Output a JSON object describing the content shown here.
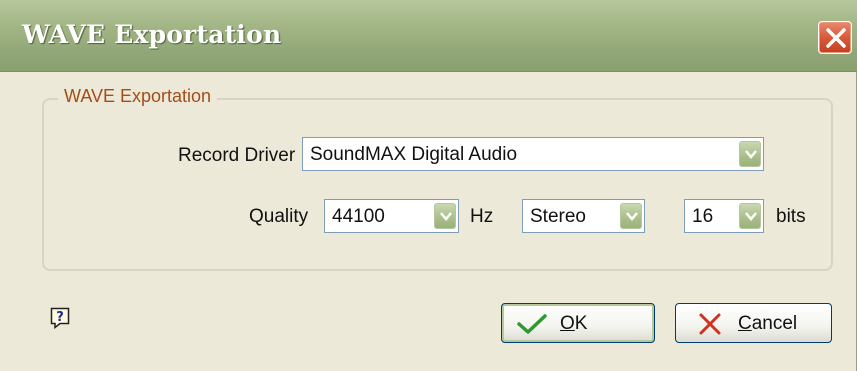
{
  "window": {
    "title": "WAVE Exportation"
  },
  "group": {
    "legend": "WAVE Exportation"
  },
  "record_driver": {
    "label": "Record Driver",
    "value": "SoundMAX Digital Audio"
  },
  "quality": {
    "label": "Quality",
    "rate_value": "44100",
    "rate_unit": "Hz",
    "channels_value": "Stereo",
    "bits_value": "16",
    "bits_unit": "bits"
  },
  "buttons": {
    "ok_prefix": "",
    "ok_mnemonic": "O",
    "ok_rest": "K",
    "cancel_mnemonic": "C",
    "cancel_rest": "ancel"
  },
  "icons": {
    "close": "close-icon",
    "help": "help-icon",
    "ok": "checkmark-icon",
    "cancel": "x-icon",
    "dropdown": "chevron-down-icon"
  },
  "colors": {
    "titlebar": "#a3b686",
    "legend_text": "#a34e1a",
    "close_button": "#d85a3a",
    "ok_icon": "#2e9a2e",
    "cancel_icon": "#d0321e"
  }
}
